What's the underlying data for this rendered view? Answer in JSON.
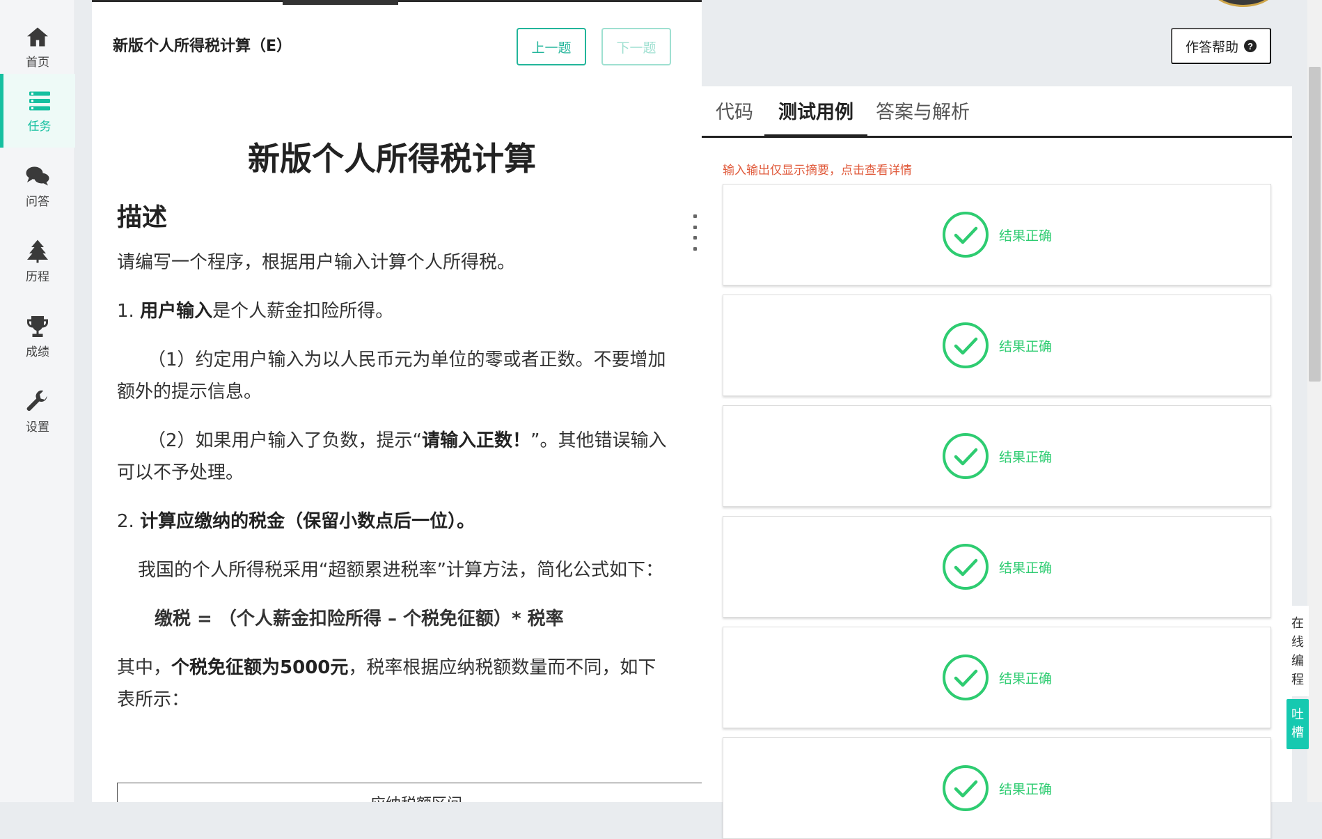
{
  "sidebar": {
    "items": [
      {
        "label": "首页",
        "icon": "home-icon"
      },
      {
        "label": "任务",
        "icon": "tasks-icon",
        "active": true
      },
      {
        "label": "问答",
        "icon": "chat-icon"
      },
      {
        "label": "历程",
        "icon": "tree-icon"
      },
      {
        "label": "成绩",
        "icon": "trophy-icon"
      },
      {
        "label": "设置",
        "icon": "wrench-icon"
      }
    ]
  },
  "problem": {
    "header_title": "新版个人所得税计算（E）",
    "prev_label": "上一题",
    "next_label": "下一题",
    "title": "新版个人所得税计算",
    "section_heading": "描述",
    "intro": "请编写一个程序，根据用户输入计算个人所得税。",
    "item1_num": "1. ",
    "item1_bold": "用户输入",
    "item1_rest": "是个人薪金扣险所得。",
    "item1_sub1": "（1）约定用户输入为以人民币元为单位的零或者正数。不要增加额外的提示信息。",
    "item1_sub2_pre": "（2）如果用户输入了负数，提示“",
    "item1_sub2_bold": "请输入正数！",
    "item1_sub2_post": "”。其他错误输入可以不予处理。",
    "item2_num": "2. ",
    "item2_bold": "计算应缴纳的税金（保留小数点后一位）。",
    "para_method": "我国的个人所得税采用“超额累进税率”计算方法，简化公式如下：",
    "formula": "缴税 = （个人薪金扣险所得 – 个税免征额）* 税率",
    "para_exempt_pre": "其中，",
    "para_exempt_bold": "个税免征额为5000元",
    "para_exempt_post": "，税率根据应纳税额数量而不同，如下表所示：",
    "table_header_partial": "应纳税额区间"
  },
  "right": {
    "help_label": "作答帮助",
    "help_icon": "question-circle-icon",
    "tabs": {
      "code": "代码",
      "tests": "测试用例",
      "answer": "答案与解析"
    },
    "notice": "输入输出仅显示摘要，点击查看详情",
    "test_results": [
      "结果正确",
      "结果正确",
      "结果正确",
      "结果正确",
      "结果正确",
      "结果正确"
    ],
    "accent_color": "#2ecc71"
  },
  "floating": {
    "online_coding": "在线编程",
    "feedback": "吐槽"
  }
}
